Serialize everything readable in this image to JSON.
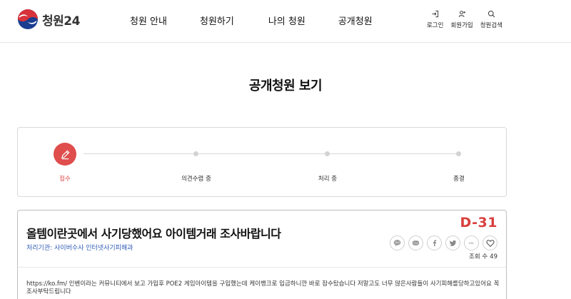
{
  "header": {
    "logo_text": "청원24",
    "nav": [
      "청원 안내",
      "청원하기",
      "나의 청원",
      "공개청원"
    ],
    "util": [
      {
        "label": "로그인",
        "icon": "login-icon"
      },
      {
        "label": "회원가입",
        "icon": "user-add-icon"
      },
      {
        "label": "청원검색",
        "icon": "search-icon"
      }
    ]
  },
  "page_title": "공개청원 보기",
  "progress": {
    "steps": [
      "접수",
      "의견수렴 중",
      "처리 중",
      "종결"
    ],
    "active_index": 0,
    "active_color": "#df4d4c"
  },
  "petition": {
    "title": "올템이란곳에서 사기당했어요 아이템거래 조사바랍니다",
    "agency": "처리기관: 사이버수사 인터넷사기피해과",
    "dday": "D-31",
    "share": [
      "kakao-talk-icon",
      "kakao-story-icon",
      "facebook-icon",
      "twitter-icon",
      "url-icon",
      "heart-icon"
    ],
    "view_label": "조회 수",
    "view_count": "49",
    "body": "https://ko.fm/ 인벤이라는 커뮤니티에서 보고 가입후 POE2 게임아이템을 구입했는데 케이뱅크로 입금하니깐 바로 잠수탔습니다 저말고도 너무 많은사람들이 사기피해를당하고있어요 꼭 조사부탁드립니다"
  },
  "colors": {
    "accent_red": "#df4d4c",
    "link_blue": "#2f5bb5"
  }
}
